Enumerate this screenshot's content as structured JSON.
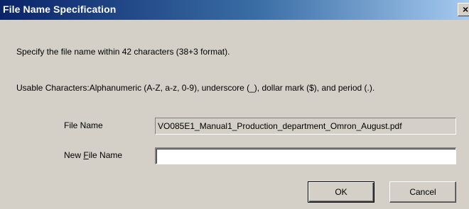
{
  "window": {
    "title": "File Name Specification",
    "close_glyph": "×"
  },
  "instructions": {
    "line1": "Specify the file name within 42 characters (38+3 format).",
    "line2": "Usable Characters:Alphanumeric (A-Z, a-z, 0-9), underscore (_), dollar mark ($), and period (.)."
  },
  "form": {
    "file_name_label": "File Name",
    "file_name_value": "VO085E1_Manual1_Production_department_Omron_August.pdf",
    "new_file_name_label_pre": "New ",
    "new_file_name_label_mnemonic": "F",
    "new_file_name_label_post": "ile Name",
    "new_file_name_value": ""
  },
  "buttons": {
    "ok_label": "OK",
    "cancel_label": "Cancel"
  },
  "colors": {
    "dialog_bg": "#d4d0c8",
    "titlebar_start": "#0a246a",
    "titlebar_end": "#a6caf0"
  }
}
